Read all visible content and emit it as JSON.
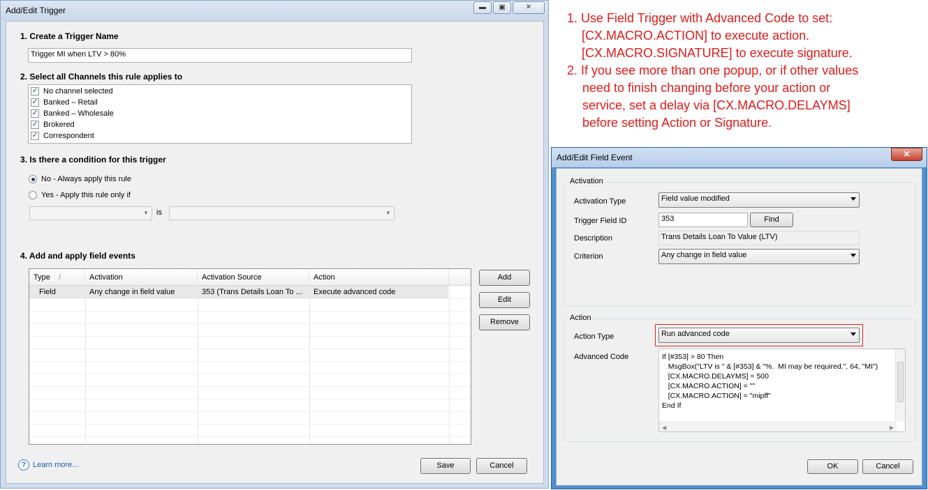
{
  "trigger_window": {
    "title": "Add/Edit Trigger",
    "controls": [
      "▬",
      "▣",
      "✕"
    ],
    "step1": {
      "heading": "1. Create a Trigger Name",
      "value": "Trigger MI when LTV > 80%"
    },
    "step2": {
      "heading": "2. Select all Channels this rule applies to",
      "channels": [
        "No channel selected",
        "Banked – Retail",
        "Banked – Wholesale",
        "Brokered",
        "Correspondent"
      ],
      "check_mark": "✓"
    },
    "step3": {
      "heading": "3. Is there a condition for this trigger",
      "option_no": "No - Always apply this rule",
      "option_yes": "Yes - Apply this rule only if",
      "selected": "no",
      "is_label": "is"
    },
    "step4": {
      "heading": "4. Add and apply field events",
      "columns": [
        "Type",
        "Activation",
        "Activation Source",
        "Action"
      ],
      "sort_indicator": "/",
      "rows": [
        {
          "type": "Field",
          "activation": "Any change in field value",
          "source": "353 (Trans Details Loan To ...",
          "action": "Execute advanced code"
        }
      ]
    },
    "buttons": {
      "add": "Add",
      "edit": "Edit",
      "remove": "Remove",
      "save": "Save",
      "cancel": "Cancel"
    },
    "learn_more": "Learn more...",
    "help_glyph": "?"
  },
  "notes": {
    "item1_num": "1.",
    "item1": [
      "Use Field Trigger with Advanced Code to set:",
      "[CX.MACRO.ACTION] to execute action.",
      "[CX.MACRO.SIGNATURE] to execute signature."
    ],
    "item2_num": "2.",
    "item2": [
      "If you see more than one popup, or if other values",
      "need to finish changing before your action or",
      "service, set a delay via [CX.MACRO.DELAYMS]",
      "before setting Action or Signature."
    ],
    "color": "#e01b1b"
  },
  "field_event_window": {
    "title": "Add/Edit Field Event",
    "close_glyph": "✕",
    "activation_group": "Activation",
    "activation_type_label": "Activation Type",
    "activation_type_value": "Field value modified",
    "trigger_field_label": "Trigger Field ID",
    "trigger_field_value": "353",
    "find_button": "Find",
    "description_label": "Description",
    "description_value": "Trans Details Loan To Value (LTV)",
    "criterion_label": "Criterion",
    "criterion_value": "Any change in field value",
    "action_group": "Action",
    "action_type_label": "Action Type",
    "action_type_value": "Run advanced code",
    "advanced_code_label": "Advanced Code",
    "advanced_code": "If [#353] > 80 Then\n   MsgBox(\"LTV is \" & [#353] & \"%.  MI may be required.\", 64, \"MI\")\n   [CX.MACRO.DELAYMS] = 500\n   [CX.MACRO.ACTION] = \"\"\n   [CX.MACRO.ACTION] = \"mipff\"\nEnd If",
    "ok": "OK",
    "cancel": "Cancel",
    "highlight_color": "#e02020"
  }
}
